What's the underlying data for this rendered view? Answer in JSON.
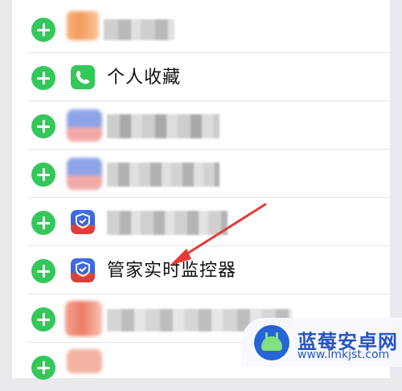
{
  "rows": [
    {
      "name": "blurred-item-1",
      "label": ""
    },
    {
      "name": "personal-favorites",
      "label": "个人收藏",
      "icon": "phone-icon"
    },
    {
      "name": "blurred-item-3",
      "label": ""
    },
    {
      "name": "blurred-item-4",
      "label": ""
    },
    {
      "name": "blurred-item-5",
      "label": "",
      "icon": "shield-app-icon"
    },
    {
      "name": "housekeeper-monitor",
      "label": "管家实时监控器",
      "icon": "shield-app-icon"
    },
    {
      "name": "blurred-item-7",
      "label": ""
    },
    {
      "name": "blurred-item-8",
      "label": ""
    }
  ],
  "watermark": {
    "title": "蓝莓安卓网",
    "url": "www.lmkjst.com"
  },
  "colors": {
    "add": "#34c759",
    "arrow": "#e53935",
    "brand": "#1f4fbf"
  }
}
